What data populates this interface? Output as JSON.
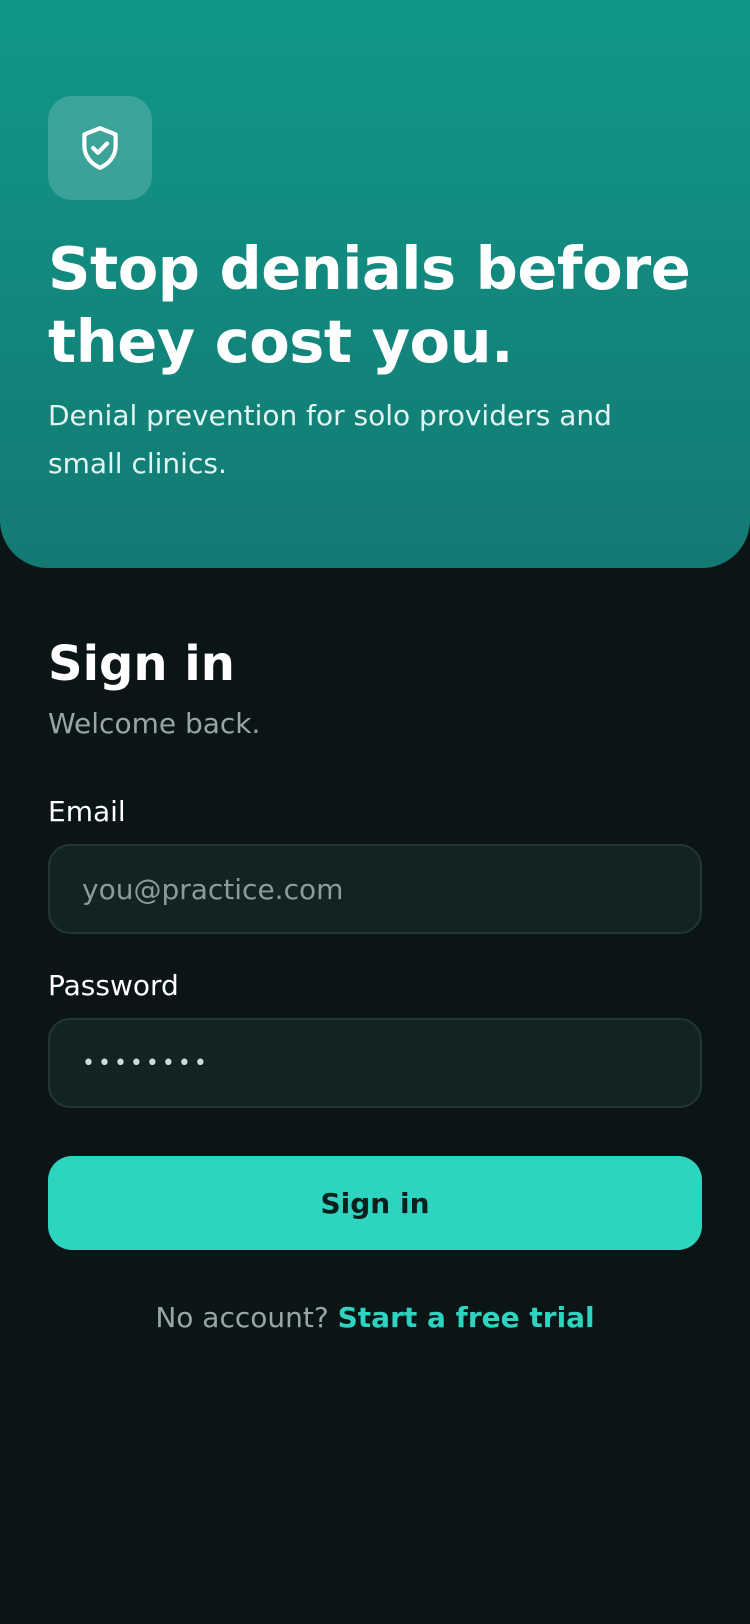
{
  "hero": {
    "icon": "shield-check-icon",
    "title": "Stop denials before they cost you.",
    "subtitle": "Denial prevention for solo providers and small clinics."
  },
  "signin": {
    "heading": "Sign in",
    "subheading": "Welcome back.",
    "email": {
      "label": "Email",
      "placeholder": "you@practice.com",
      "value": ""
    },
    "password": {
      "label": "Password",
      "value": "••••••••"
    },
    "submit_label": "Sign in"
  },
  "footer": {
    "prompt": "No account?",
    "link_label": "Start a free trial"
  },
  "colors": {
    "accent": "#2dd4bf",
    "hero_top": "#119788",
    "hero_bottom": "#137a73",
    "background": "#0b1516",
    "input_bg": "#122322"
  }
}
